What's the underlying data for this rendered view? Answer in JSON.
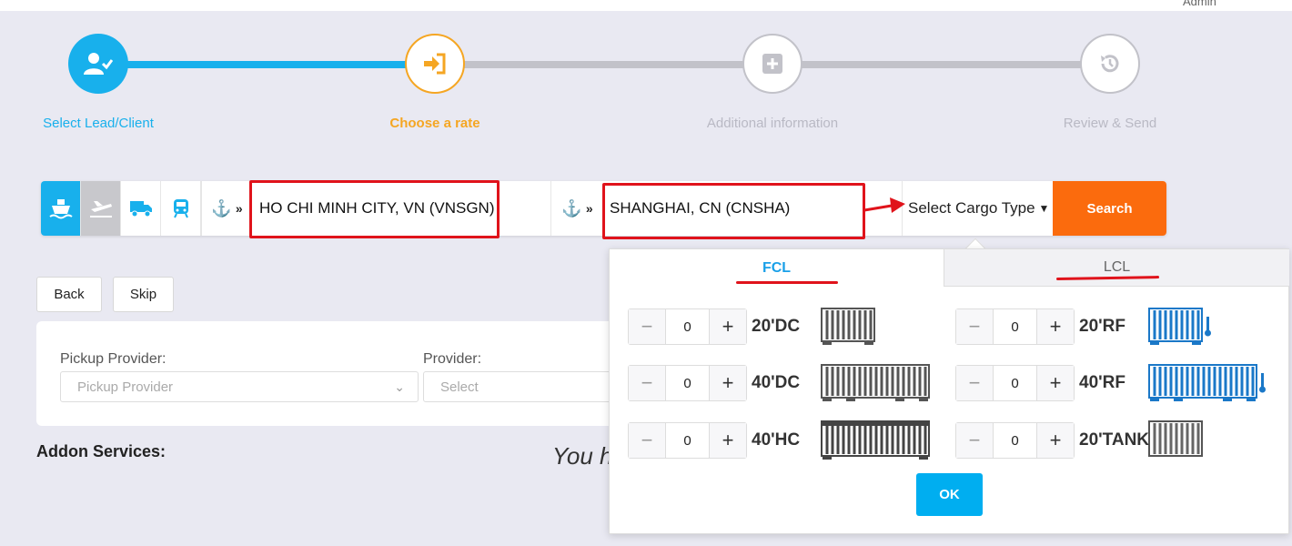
{
  "header": {
    "user": "Admin"
  },
  "steps": [
    {
      "label": "Select Lead/Client",
      "state": "done",
      "color": "#18b0ec"
    },
    {
      "label": "Choose a rate",
      "state": "active",
      "color": "#f5a623"
    },
    {
      "label": "Additional information",
      "state": "pending",
      "color": "#b9b9c4"
    },
    {
      "label": "Review & Send",
      "state": "pending",
      "color": "#b9b9c4"
    }
  ],
  "search": {
    "modes": [
      "sea-freight-icon",
      "air-freight-icon",
      "truck-icon",
      "rail-icon"
    ],
    "origin": "HO CHI MINH CITY, VN (VNSGN)",
    "destination": "SHANGHAI, CN (CNSHA)",
    "cargo_type": "Select Cargo Type",
    "search_label": "Search"
  },
  "actions": {
    "back": "Back",
    "skip": "Skip"
  },
  "providers": {
    "pickup_label": "Pickup Provider:",
    "pickup_placeholder": "Pickup Provider",
    "provider_label": "Provider:",
    "provider_placeholder": "Select"
  },
  "addon": {
    "title": "Addon Services:",
    "message": "You h"
  },
  "cargo_panel": {
    "tabs": [
      "FCL",
      "LCL"
    ],
    "containers": [
      {
        "name": "20'DC",
        "qty": "0"
      },
      {
        "name": "20'RF",
        "qty": "0"
      },
      {
        "name": "40'DC",
        "qty": "0"
      },
      {
        "name": "40'RF",
        "qty": "0"
      },
      {
        "name": "40'HC",
        "qty": "0"
      },
      {
        "name": "20'TANK",
        "qty": "0"
      }
    ],
    "ok_label": "OK"
  },
  "colors": {
    "accent": "#18b0ec",
    "orange": "#fb6b0d",
    "highlight": "#e0131b"
  }
}
